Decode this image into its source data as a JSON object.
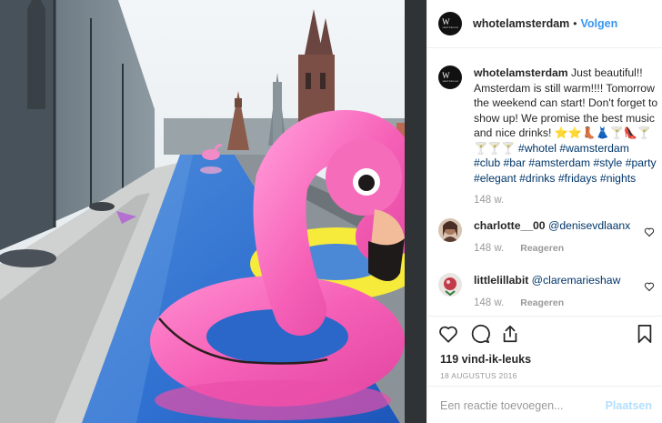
{
  "header": {
    "avatar_text": "W",
    "avatar_subtext": "AMSTERDAM",
    "username": "whotelamsterdam",
    "separator": "•",
    "follow_label": "Volgen"
  },
  "caption": {
    "username": "whotelamsterdam",
    "text": "Just beautiful!! Amsterdam is still warm!!!! Tomorrow the weekend can start! Don't forget to show up! We promise the best music and nice drinks! ⭐⭐👢👗🍸👠🍸🍸🍸🍸",
    "hashtags": [
      "#whotel",
      "#wamsterdam",
      "#club",
      "#bar",
      "#amsterdam",
      "#style",
      "#party",
      "#elegant",
      "#drinks",
      "#fridays",
      "#nights"
    ],
    "age": "148 w."
  },
  "comments": [
    {
      "username": "charlotte__00",
      "mention": "@denisevdlaanx",
      "age": "148 w.",
      "reply_label": "Reageren"
    },
    {
      "username": "littlelillabit",
      "mention": "@claremarieshaw",
      "age": "148 w.",
      "reply_label": "Reageren"
    }
  ],
  "actions": {
    "icons": [
      "heart-icon",
      "comment-icon",
      "share-icon",
      "bookmark-icon"
    ],
    "likes": "119 vind-ik-leuks",
    "date": "18 AUGUSTUS 2016"
  },
  "add_comment": {
    "placeholder": "Een reactie toevoegen...",
    "post_label": "Plaatsen"
  },
  "colors": {
    "link": "#003569",
    "follow": "#3897f0",
    "muted": "#999999",
    "post_disabled": "#b2dffc",
    "flamingo": "#f25fb4"
  }
}
